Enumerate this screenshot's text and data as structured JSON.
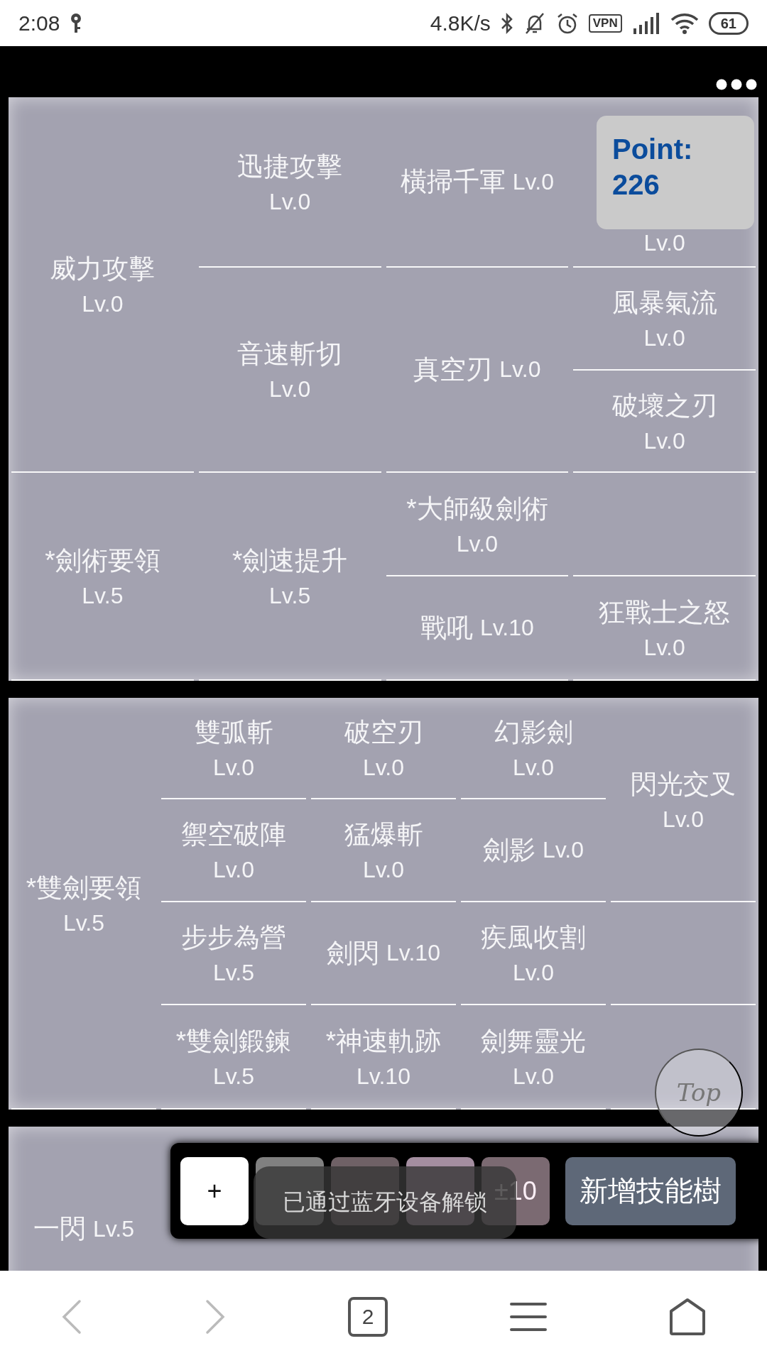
{
  "status_bar": {
    "time": "2:08",
    "speed": "4.8K/s",
    "vpn": "VPN",
    "battery": "61"
  },
  "skill_trees": [
    {
      "cells": [
        {
          "name": "威力攻擊",
          "level": "Lv.0",
          "kind": "stacked",
          "rowspan": 3
        },
        {
          "name": "*劍術要領",
          "level": "Lv.5",
          "kind": "stacked",
          "rowspan": 2
        },
        {
          "name": "迅捷攻擊",
          "level": "Lv.0",
          "kind": "stacked"
        },
        {
          "name": "音速斬切",
          "level": "Lv.0",
          "kind": "stacked",
          "rowspan": 2
        },
        {
          "name": "*劍速提升",
          "level": "Lv.5",
          "kind": "stacked",
          "rowspan": 2
        },
        {
          "name": "橫掃千軍",
          "level": "Lv.0",
          "kind": "inline"
        },
        {
          "name": "真空刃",
          "level": "Lv.0",
          "kind": "inline",
          "rowspan": 2
        },
        {
          "name": "*大師級劍術",
          "level": "Lv.0",
          "kind": "stacked"
        },
        {
          "name": "戰吼",
          "level": "Lv.10",
          "kind": "inline"
        },
        {
          "level": "Lv.0",
          "kind": "stacked"
        },
        {
          "name": "風暴氣流",
          "level": "Lv.0",
          "kind": "stacked"
        },
        {
          "name": "破壞之刃",
          "level": "Lv.0",
          "kind": "stacked"
        },
        {
          "kind": "empty"
        },
        {
          "name": "狂戰士之怒",
          "level": "Lv.0",
          "kind": "stacked"
        }
      ]
    },
    {
      "cells": [
        {
          "name": "*雙劍要領",
          "level": "Lv.5",
          "kind": "stacked",
          "rowspan": 4
        },
        {
          "name": "雙弧斬",
          "level": "Lv.0",
          "kind": "stacked"
        },
        {
          "name": "禦空破陣",
          "level": "Lv.0",
          "kind": "stacked"
        },
        {
          "name": "步步為營",
          "level": "Lv.5",
          "kind": "stacked"
        },
        {
          "name": "*雙劍鍛鍊",
          "level": "Lv.5",
          "kind": "stacked"
        },
        {
          "name": "破空刃",
          "level": "Lv.0",
          "kind": "stacked"
        },
        {
          "name": "猛爆斬",
          "level": "Lv.0",
          "kind": "stacked"
        },
        {
          "name": "劍閃",
          "level": "Lv.10",
          "kind": "inline"
        },
        {
          "name": "*神速軌跡",
          "level": "Lv.10",
          "kind": "stacked"
        },
        {
          "name": "幻影劍",
          "level": "Lv.0",
          "kind": "stacked"
        },
        {
          "name": "劍影",
          "level": "Lv.0",
          "kind": "inline"
        },
        {
          "name": "疾風收割",
          "level": "Lv.0",
          "kind": "stacked"
        },
        {
          "name": "劍舞靈光",
          "level": "Lv.0",
          "kind": "stacked"
        },
        {
          "name": "閃光交叉",
          "level": "Lv.0",
          "kind": "stacked",
          "rowspan": 2
        },
        {
          "kind": "empty"
        },
        {
          "kind": "empty"
        }
      ]
    },
    {
      "cells": [
        {
          "name": "一閃",
          "level": "Lv.5",
          "kind": "inline"
        }
      ]
    }
  ],
  "points": {
    "label": "Point:",
    "value": "226"
  },
  "top_button": {
    "label": "Top"
  },
  "toolbar": {
    "buttons": [
      {
        "label": "+",
        "color": "#ffffff"
      },
      {
        "color": "#808080"
      },
      {
        "color": "#6f6166"
      },
      {
        "color": "#a48ea0"
      },
      {
        "label": "±10",
        "color": "#7b6a72"
      }
    ],
    "add_tree": "新增技能樹"
  },
  "toast": "已通过蓝牙设备解锁",
  "browser_nav": {
    "tabs_count": "2"
  }
}
